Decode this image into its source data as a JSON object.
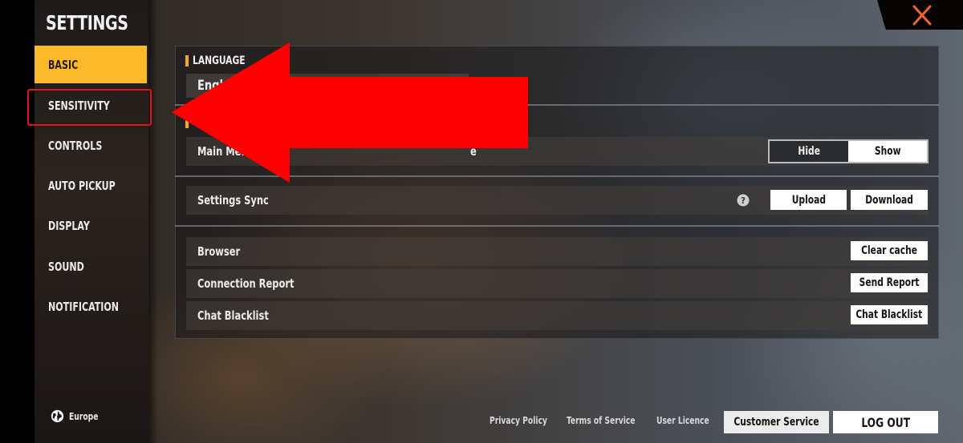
{
  "sidebar": {
    "title": "SETTINGS",
    "items": [
      {
        "label": "BASIC",
        "active": true
      },
      {
        "label": "SENSITIVITY",
        "active": false,
        "highlighted": true
      },
      {
        "label": "CONTROLS",
        "active": false
      },
      {
        "label": "AUTO PICKUP",
        "active": false
      },
      {
        "label": "DISPLAY",
        "active": false
      },
      {
        "label": "SOUND",
        "active": false
      },
      {
        "label": "NOTIFICATION",
        "active": false
      }
    ],
    "region": {
      "icon": "globe-icon",
      "label": "Europe"
    }
  },
  "header": {
    "close_icon": "close-icon"
  },
  "main": {
    "language": {
      "section_label": "LANGUAGE",
      "value_visible": "Engl"
    },
    "display_section": {
      "row_label_visible_start": "Main Men",
      "row_label_visible_end": "e",
      "toggle": {
        "options": [
          "Hide",
          "Show"
        ],
        "selected": "Show"
      }
    },
    "settings_sync": {
      "label": "Settings Sync",
      "help_icon": "question-icon",
      "buttons": [
        "Upload",
        "Download"
      ]
    },
    "misc_rows": [
      {
        "label": "Browser",
        "button": "Clear cache"
      },
      {
        "label": "Connection Report",
        "button": "Send Report"
      },
      {
        "label": "Chat Blacklist",
        "button": "Chat Blacklist"
      }
    ]
  },
  "footer": {
    "links": [
      "Privacy Policy",
      "Terms of Service",
      "User Licence"
    ],
    "customer_service": "Customer Service",
    "logout": "LOG OUT"
  },
  "annotation": {
    "arrow_color": "#ff0000",
    "highlight_color": "#e0141a",
    "accent": "#fcb92a"
  }
}
